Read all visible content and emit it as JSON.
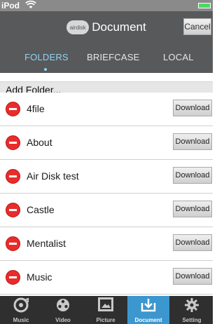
{
  "status_bar": {
    "carrier": "iPod",
    "wifi": "wifi-icon",
    "battery": "battery-icon"
  },
  "header": {
    "logo_text": "airdisk",
    "title": "Document",
    "cancel_label": "Cancel"
  },
  "tabs": [
    {
      "label": "FOLDERS",
      "active": true
    },
    {
      "label": "BRIEFCASE",
      "active": false
    },
    {
      "label": "LOCAL",
      "active": false
    }
  ],
  "list": {
    "add_folder_label": "Add Folder...",
    "download_label": "Download",
    "items": [
      {
        "name": "4file"
      },
      {
        "name": "About"
      },
      {
        "name": "Air Disk test"
      },
      {
        "name": "Castle"
      },
      {
        "name": "Mentalist"
      },
      {
        "name": "Music"
      }
    ]
  },
  "tab_bar": {
    "items": [
      {
        "label": "Music",
        "icon": "music-disc-icon",
        "active": false
      },
      {
        "label": "Video",
        "icon": "film-reel-icon",
        "active": false
      },
      {
        "label": "Picture",
        "icon": "picture-icon",
        "active": false
      },
      {
        "label": "Document",
        "icon": "document-download-icon",
        "active": true
      },
      {
        "label": "Setting",
        "icon": "gear-icon",
        "active": false
      }
    ]
  },
  "colors": {
    "nav_bg": "#58595b",
    "active_tab_text": "#8ed3f5",
    "tab_bar_active": "#3b97ce",
    "delete_red": "#ea2b2b"
  }
}
